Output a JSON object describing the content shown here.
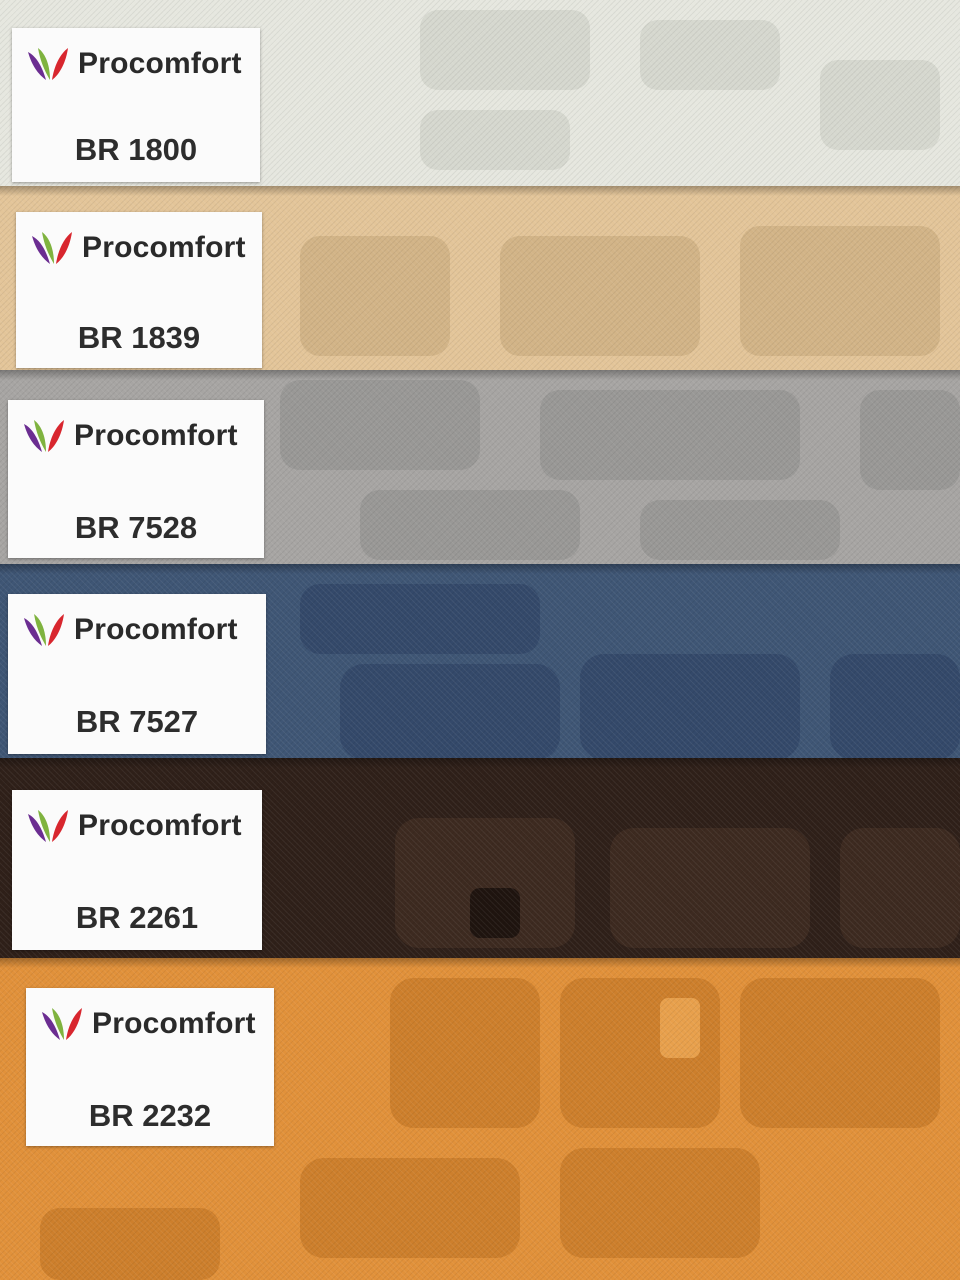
{
  "icon": "procomfort-leaf-logo-icon",
  "swatches": [
    {
      "brand": "Procomfort",
      "code": "BR 1800",
      "color": "#e6e7df",
      "motif": "#d6d8cf"
    },
    {
      "brand": "Procomfort",
      "code": "BR 1839",
      "color": "#e3c599",
      "motif": "#d2b487"
    },
    {
      "brand": "Procomfort",
      "code": "BR 7528",
      "color": "#a7a5a3",
      "motif": "#999896"
    },
    {
      "brand": "Procomfort",
      "code": "BR 7527",
      "color": "#3f5675",
      "motif": "#34496a"
    },
    {
      "brand": "Procomfort",
      "code": "BR 2261",
      "color": "#2f2019",
      "motif": "#3d2a20"
    },
    {
      "brand": "Procomfort",
      "code": "BR 2232",
      "color": "#e1913a",
      "motif": "#cd7f2c"
    }
  ]
}
